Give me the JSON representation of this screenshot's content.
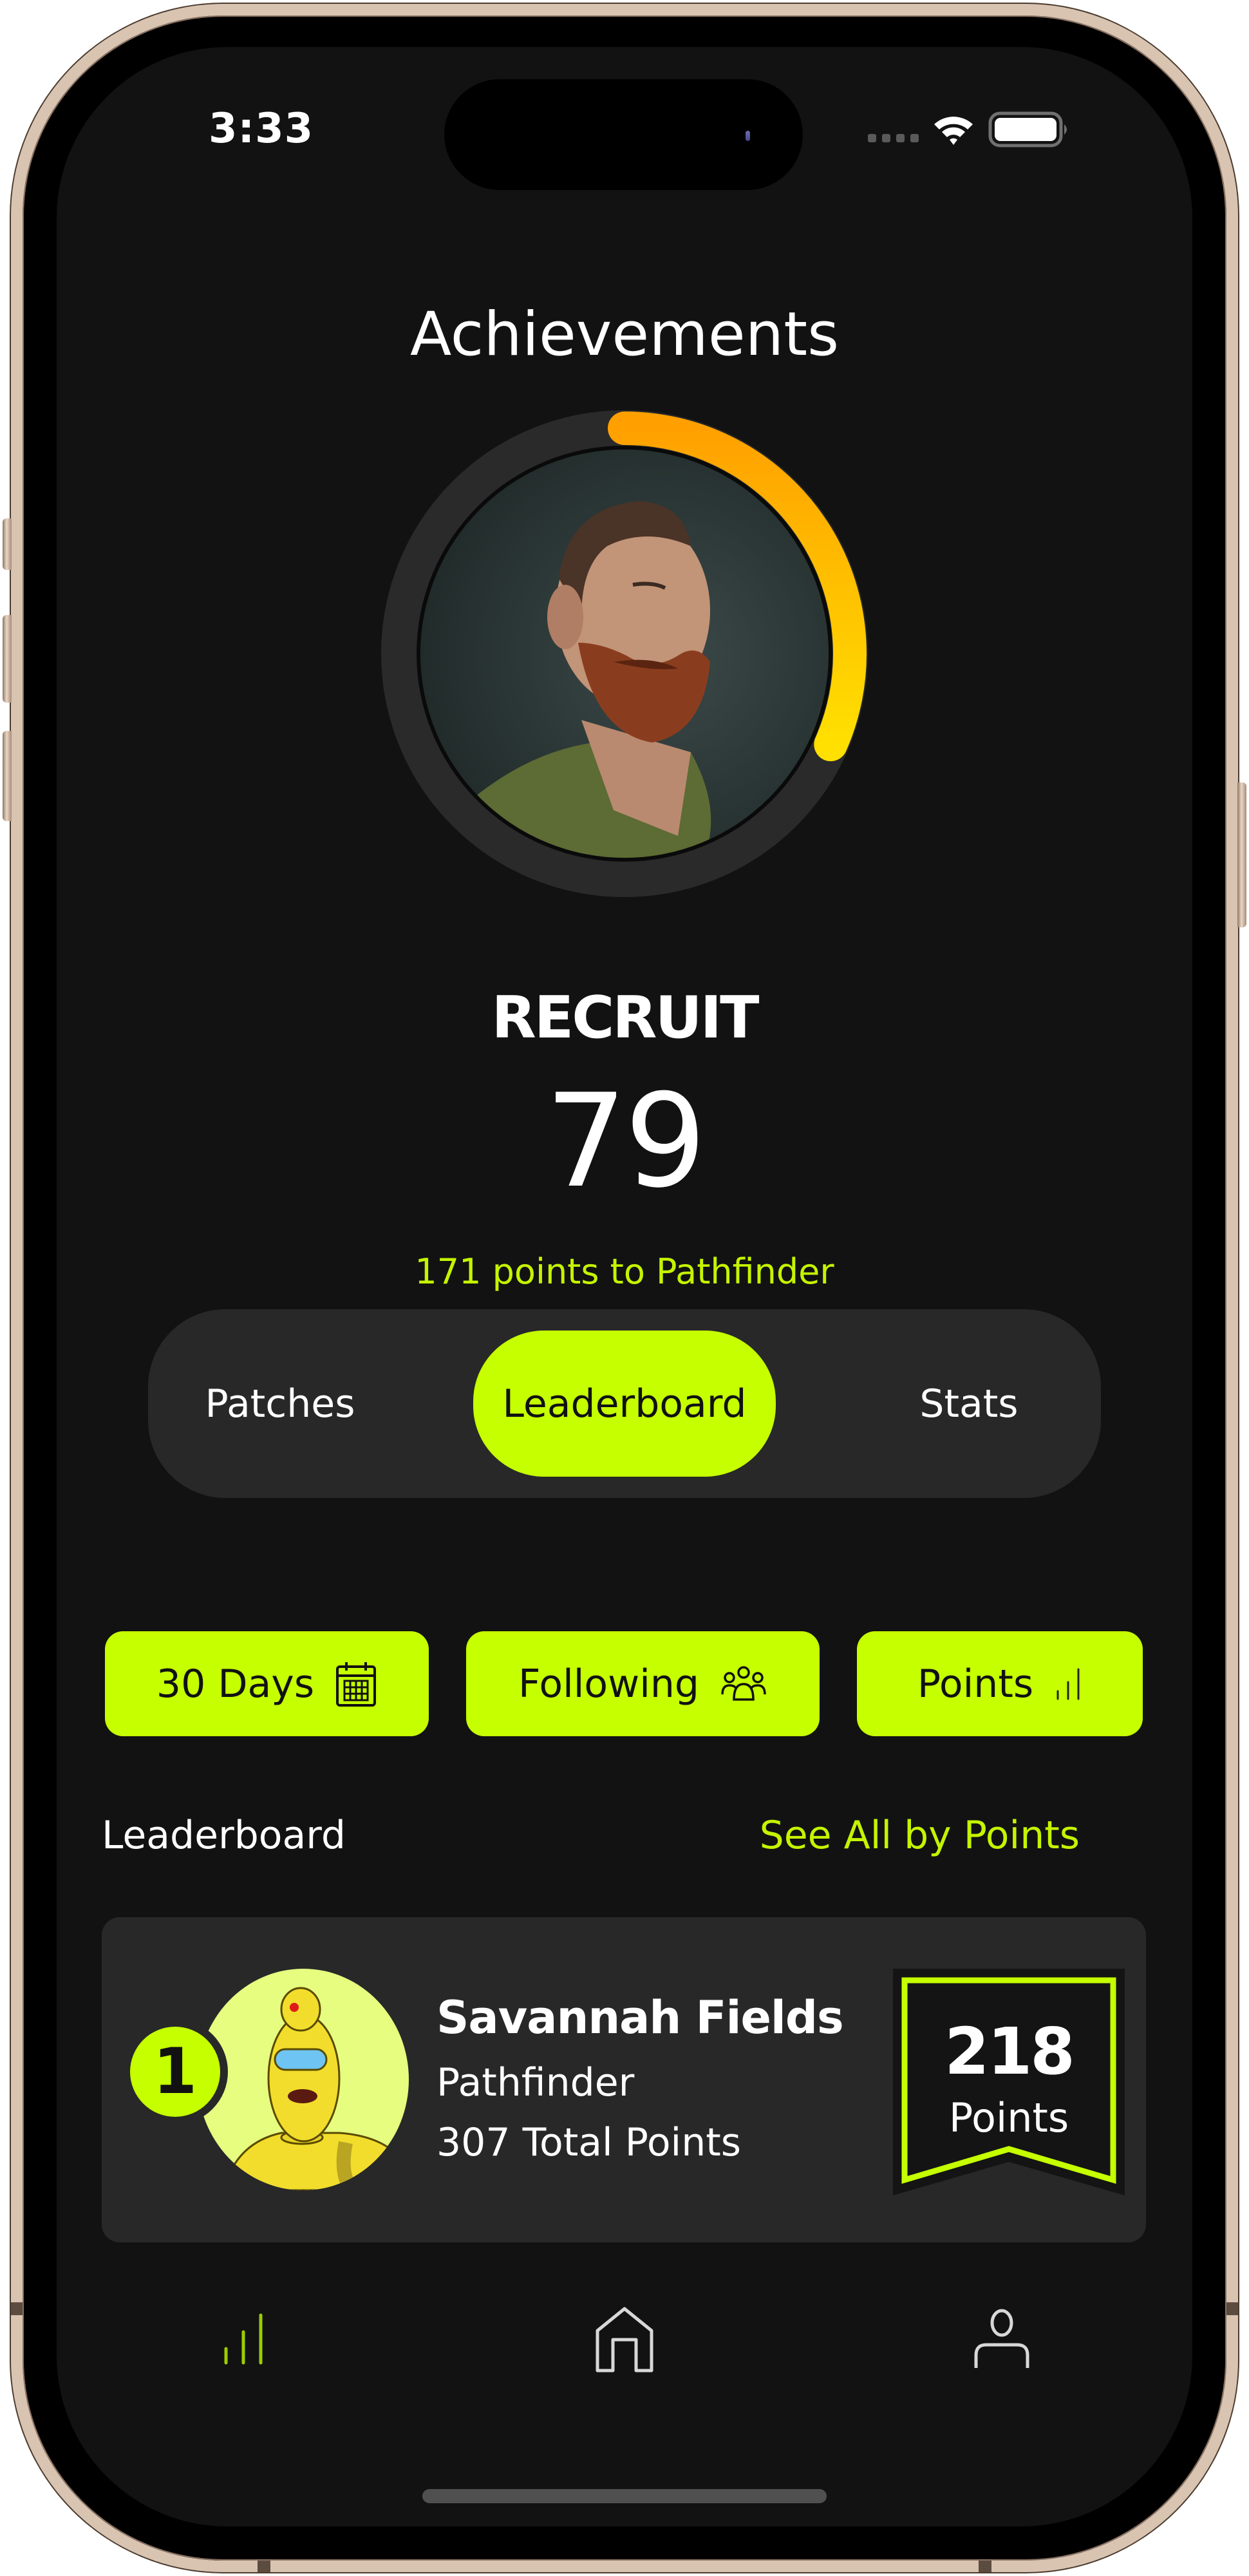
{
  "status_bar": {
    "time": "3:33",
    "cellular": "no-service",
    "wifi": "full",
    "battery_percent": 100
  },
  "header": {
    "title": "Achievements"
  },
  "profile": {
    "avatar": "bearded-man-portrait",
    "progress_fraction": 0.316,
    "progress_colors": {
      "start": "#FFA000",
      "end": "#FFE000",
      "track": "#2A2A2A"
    },
    "rank_name": "RECRUIT",
    "points": "79",
    "next_rank_text": "171 points to Pathfinder"
  },
  "tabs": [
    {
      "label": "Patches",
      "active": false
    },
    {
      "label": "Leaderboard",
      "active": true
    },
    {
      "label": "Stats",
      "active": false
    }
  ],
  "filters": [
    {
      "label": "30 Days",
      "icon": "calendar-icon"
    },
    {
      "label": "Following",
      "icon": "people-icon"
    },
    {
      "label": "Points",
      "icon": "bar-chart-icon"
    }
  ],
  "leaderboard": {
    "heading": "Leaderboard",
    "see_all_label": "See All by Points",
    "entries": [
      {
        "rank": "1",
        "avatar": "yellow-robot-avatar",
        "name": "Savannah Fields",
        "rank_title": "Pathfinder",
        "total_points": "307 Total Points",
        "period_points": "218",
        "period_points_label": "Points"
      }
    ]
  },
  "bottom_nav": [
    {
      "name": "leaderboard",
      "icon": "bar-chart-icon",
      "active": true
    },
    {
      "name": "home",
      "icon": "home-icon",
      "active": false
    },
    {
      "name": "profile",
      "icon": "user-icon",
      "active": false
    }
  ],
  "colors": {
    "accent": "#C5FF00",
    "accent_text": "#C5F400",
    "background": "#121212",
    "surface": "#282828"
  }
}
